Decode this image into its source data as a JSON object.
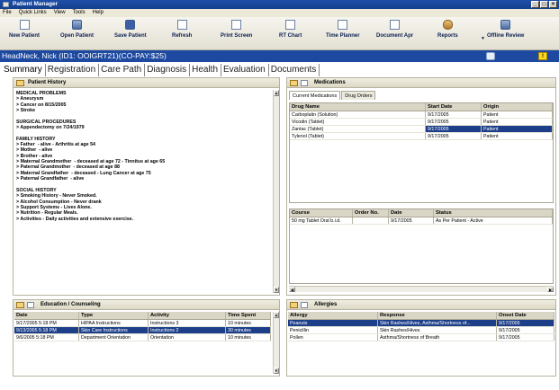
{
  "window": {
    "title": "Patient Manager",
    "buttons": [
      "_",
      "□",
      "×"
    ]
  },
  "menu": [
    "File",
    "Quick Links",
    "View",
    "Tools",
    "Help"
  ],
  "toolbar": {
    "new_patient": "New Patient",
    "open_patient": "Open Patient",
    "save_patient": "Save Patient",
    "refresh": "Refresh",
    "print_screen": "Print Screen",
    "rt_chart": "RT Chart",
    "time_planner": "Time Planner",
    "document_apr": "Document Apr",
    "reports": "Reports",
    "offline_review": "Offline Review"
  },
  "patient_bar": {
    "text": "HeadNeck, Nick (ID1: OOIGRT21)(CO-PAY:$25)",
    "alert": "!"
  },
  "tabs": [
    "Summary",
    "Registration",
    "Care Path",
    "Diagnosis",
    "Health",
    "Evaluation",
    "Documents"
  ],
  "history": {
    "title": "Patient History",
    "text": "MEDICAL PROBLEMS\n> Aneurysm\n> Cancer on 8/15/2005\n> Stroke\n\nSURGICAL PROCEDURES\n> Appendectomy on 7/24/1979\n\nFAMILY HISTORY\n> Father  - alive - Arthritis at age 54\n> Mother  - alive\n> Brother - alive\n> Maternal Grandmother  - deceased at age 72 - Tinnitus at age 65\n> Paternal Grandmother  - deceased at age 88\n> Maternal Grandfather  - deceased - Lung Cancer at age 75\n> Paternal Grandfather  - alive\n\nSOCIAL HISTORY\n> Smoking History - Never Smoked.\n> Alcohol Consumption - Never drank\n> Support Systems - Lives Alone.\n> Nutrition - Regular Meals.\n> Activities - Daily activities and extensive exercise."
  },
  "medications": {
    "title": "Medications",
    "subtabs": [
      "Current Medications",
      "Drug Orders"
    ],
    "columns": [
      "Drug Name",
      "Start Date",
      "Origin"
    ],
    "rows": [
      [
        "Carboplatin (Solution)",
        "9/17/2005",
        "Patient"
      ],
      [
        "Vicodin (Tablet)",
        "9/17/2005",
        "Patient"
      ],
      [
        "Zantac (Tablet)",
        "9/17/2005",
        "Patient"
      ],
      [
        "Tylenol (Tablet)",
        "9/17/2005",
        "Patient"
      ]
    ],
    "selected_row": 2,
    "detail_columns": [
      "Course",
      "Order No.",
      "Date",
      "Status"
    ],
    "detail_rows": [
      [
        "50 mg Tablet Oral b.i.d.",
        "",
        "9/17/2005",
        "As Per Patient - Active"
      ]
    ]
  },
  "education": {
    "title": "Education / Counseling",
    "columns": [
      "Date",
      "Type",
      "Activity",
      "Time Spent"
    ],
    "rows": [
      [
        "9/17/2005 5:18 PM",
        "HIPAA Instructions",
        "Instructions 3",
        "10 minutes"
      ],
      [
        "9/13/2005 5:18 PM",
        "Skin Care Instructions",
        "Instructions 2",
        "30 minutes"
      ],
      [
        "9/6/2005 5:18 PM",
        "Department Orientation",
        "Orientation",
        "10 minutes"
      ]
    ],
    "selected_row": 1
  },
  "allergies": {
    "title": "Allergies",
    "columns": [
      "Allergy",
      "Response",
      "Onset Date"
    ],
    "rows": [
      [
        "Peanuts",
        "Skin Rashes/Hives, Asthma/Shortness of...",
        "9/17/2005"
      ],
      [
        "Penicillin",
        "Skin Rashes/Hives",
        "9/17/2005"
      ],
      [
        "Pollen",
        "Asthma/Shortness of Breath",
        "9/17/2005"
      ]
    ],
    "selected_row": 0
  },
  "colors": {
    "titlebar": "#1d4fa8",
    "patient_bar": "#1d4aa0",
    "selection": "#1d3f8a",
    "panel_border": "#b7b3a0"
  }
}
